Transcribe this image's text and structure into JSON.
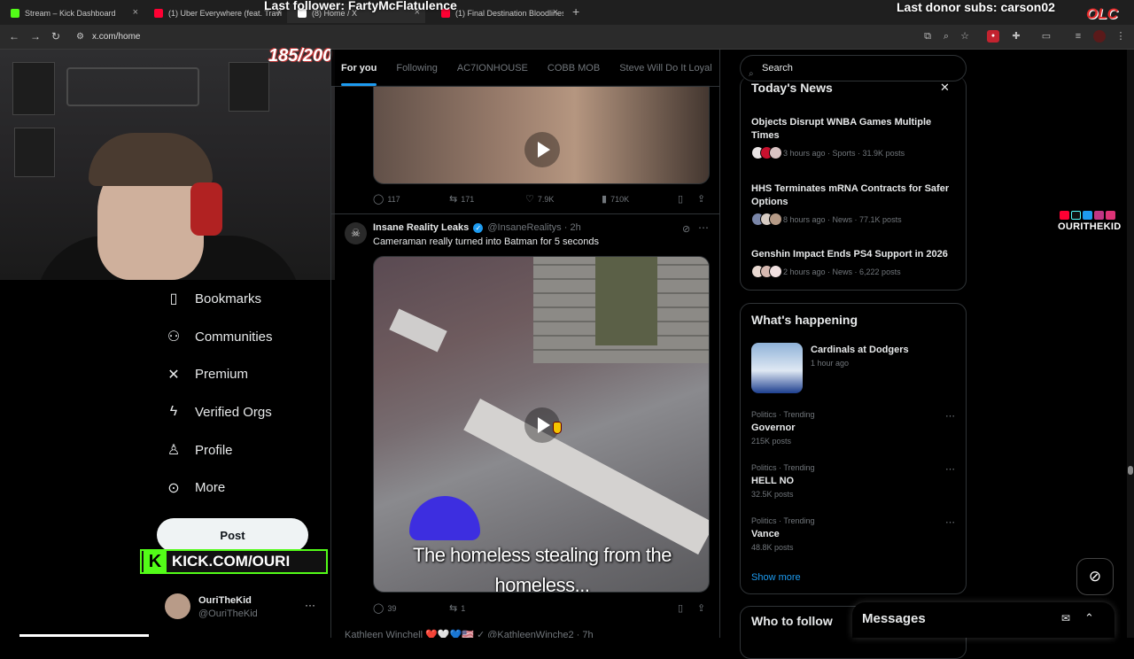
{
  "browser": {
    "tabs": [
      {
        "title": "Stream – Kick Dashboard",
        "color": "#53fc18"
      },
      {
        "title": "(1) Uber Everywhere (feat. Travi",
        "color": "#ff0033"
      },
      {
        "title": "(8) Home / X",
        "color": "#ffffff"
      },
      {
        "title": "(1) Final Destination Bloodlines",
        "color": "#ff0033"
      }
    ],
    "new_tab": "+",
    "url": "x.com/home"
  },
  "overlay": {
    "last_follower": "Last follower: FartyMcFlatulence",
    "last_donor": "Last donor subs: carson02",
    "logo": "OLC",
    "goal": "185/200",
    "social_name": "OURITHEKID",
    "kick_text": "KICK.COM/OURI",
    "kick_letter": "K"
  },
  "nav": {
    "items": [
      {
        "label": "Bookmarks",
        "icon": "bookmark-icon",
        "glyph": "🔖"
      },
      {
        "label": "Communities",
        "icon": "communities-icon",
        "glyph": "👥"
      },
      {
        "label": "Premium",
        "icon": "x-logo-icon",
        "glyph": "𝕏"
      },
      {
        "label": "Verified Orgs",
        "icon": "lightning-icon",
        "glyph": "⚡"
      },
      {
        "label": "Profile",
        "icon": "profile-icon",
        "glyph": "👤"
      },
      {
        "label": "More",
        "icon": "more-circle-icon",
        "glyph": "⋯"
      }
    ],
    "post_label": "Post",
    "account_name": "OuriTheKid",
    "account_handle": "@OuriTheKid",
    "account_more": "···"
  },
  "feed": {
    "tabs": [
      "For you",
      "Following",
      "AC7IONHOUSE",
      "COBB MOB",
      "Steve Will Do It Loyal"
    ],
    "tweet1": {
      "replies": "117",
      "reposts": "171",
      "likes": "7.9K",
      "views": "710K"
    },
    "tweet2": {
      "name": "Insane Reality Leaks",
      "handle": "@InsaneRealitys · 2h",
      "text": "Cameraman really turned into Batman for 5 seconds",
      "caption": "The homeless stealing from the homeless...",
      "replies": "39",
      "reposts": "1"
    },
    "tweet3_partial": "Kathleen Winchell ❤️🤍💙🇺🇸 ✓ @KathleenWinche2 · 7h"
  },
  "right": {
    "search_placeholder": "Search",
    "news_title": "Today's News",
    "news": [
      {
        "title": "Objects Disrupt WNBA Games Multiple Times",
        "meta": "3 hours ago · Sports · 31.9K posts"
      },
      {
        "title": "HHS Terminates mRNA Contracts for Safer Options",
        "meta": "8 hours ago · News · 77.1K posts"
      },
      {
        "title": "Genshin Impact Ends PS4 Support in 2026",
        "meta": "2 hours ago · News · 6,222 posts"
      }
    ],
    "happening_title": "What's happening",
    "event_title": "Cardinals at Dodgers",
    "event_time": "1 hour ago",
    "trends": [
      {
        "context": "Politics · Trending",
        "name": "Governor",
        "posts": "215K posts"
      },
      {
        "context": "Politics · Trending",
        "name": "HELL NO",
        "posts": "32.5K posts"
      },
      {
        "context": "Politics · Trending",
        "name": "Vance",
        "posts": "48.8K posts"
      }
    ],
    "show_more": "Show more",
    "who_to_follow": "Who to follow"
  },
  "messages": {
    "title": "Messages"
  },
  "colors": {
    "accent": "#1d9bf0",
    "kick_green": "#53fc18",
    "bg": "#000000"
  }
}
